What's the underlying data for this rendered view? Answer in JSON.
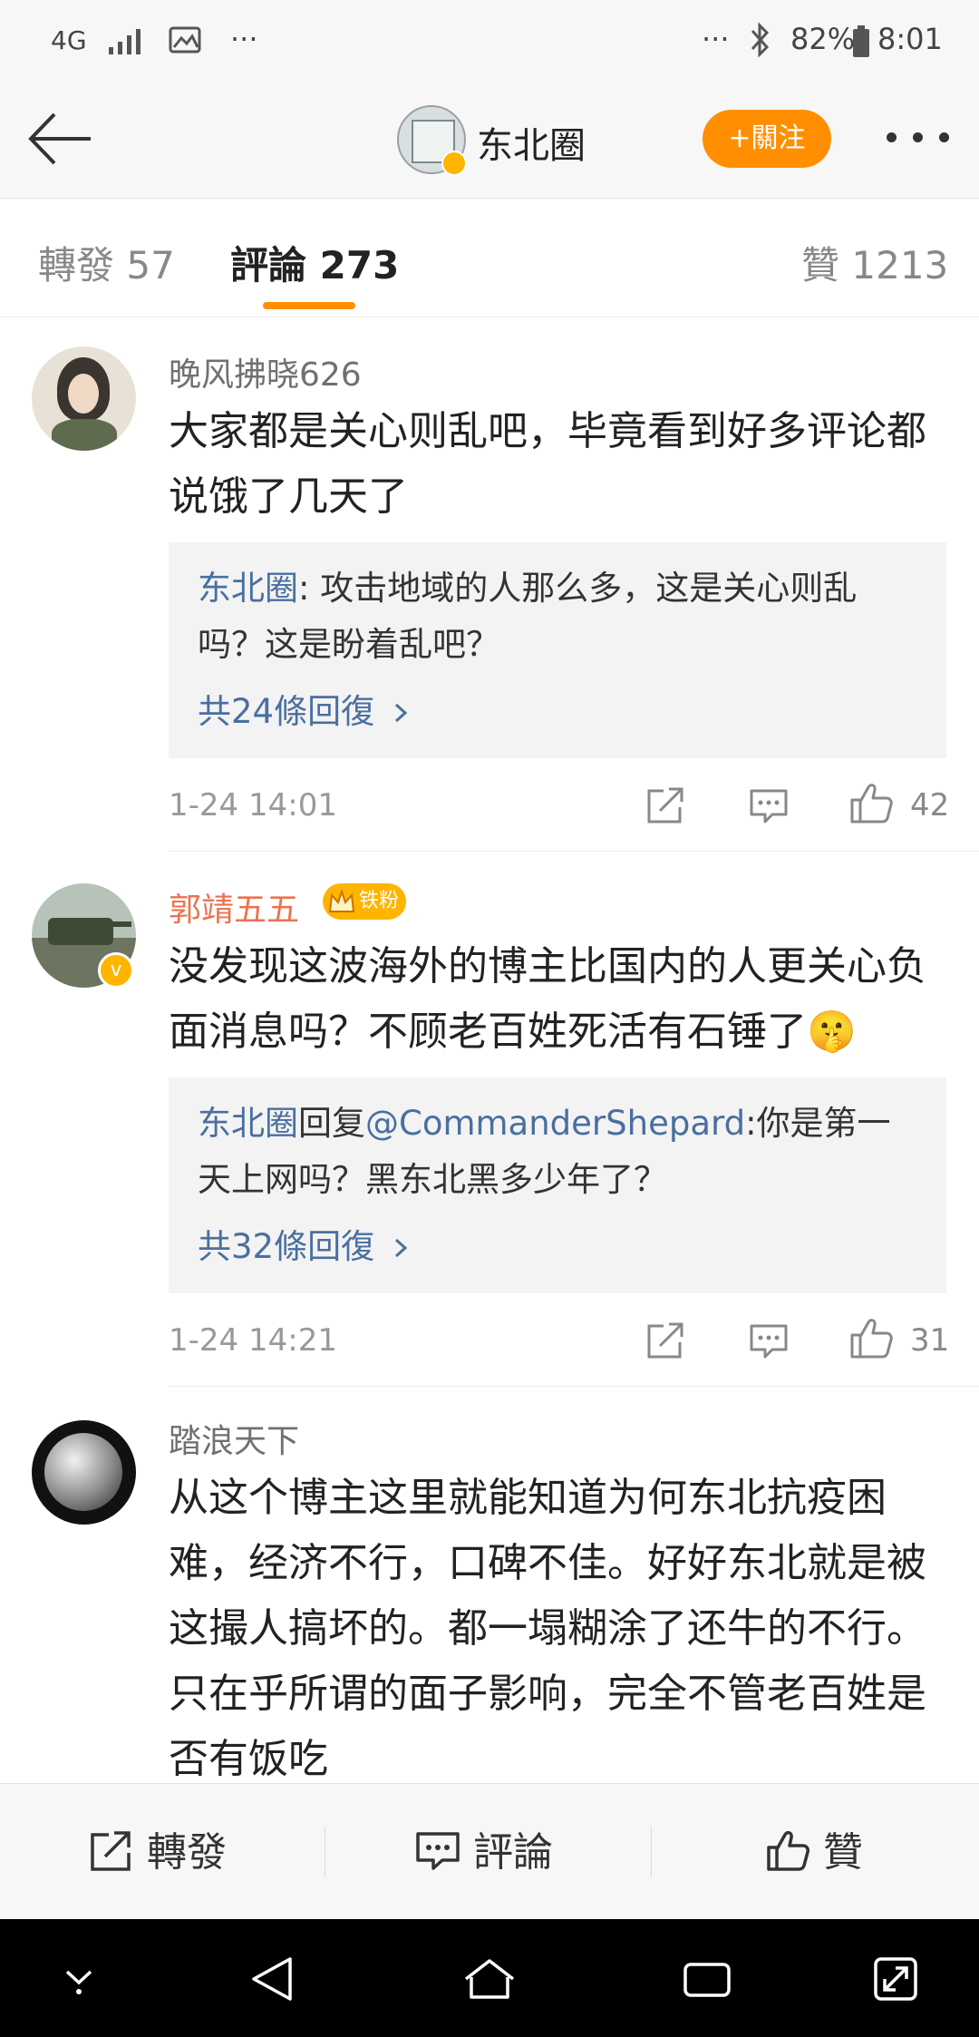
{
  "status": {
    "network": "4G",
    "battery": "82%",
    "time": "8:01",
    "more": "···",
    "right_more": "···"
  },
  "header": {
    "account_name": "东北圈",
    "follow_label": "+關注"
  },
  "tabs": [
    {
      "label": "轉發",
      "count": "57"
    },
    {
      "label": "評論",
      "count": "273"
    },
    {
      "label": "贊",
      "count": "1213"
    }
  ],
  "comments": [
    {
      "user": "晚风拂晓626",
      "text": "大家都是关心则乱吧，毕竟看到好多评论都说饿了几天了",
      "reply": {
        "author": "东北圈",
        "connector": "",
        "mention": "",
        "text": ": 攻击地域的人那么多，这是关心则乱吗？这是盼着乱吧？"
      },
      "reply_count": "共24條回復",
      "time": "1-24 14:01",
      "likes": "42"
    },
    {
      "user": "郭靖五五",
      "badge": "铁粉",
      "text": "没发现这波海外的博主比国内的人更关心负面消息吗？不顾老百姓死活有石锤了🤫",
      "reply": {
        "author": "东北圈",
        "connector": "回复",
        "mention": "@CommanderShepard",
        "text": ":你是第一天上网吗？黑东北黑多少年了？"
      },
      "reply_count": "共32條回復",
      "time": "1-24 14:21",
      "likes": "31"
    },
    {
      "user": "踏浪天下",
      "text": "从这个博主这里就能知道为何东北抗疫困难，经济不行，口碑不佳。好好东北就是被这撮人搞坏的。都一塌糊涂了还牛的不行。只在乎所谓的面子影响，完全不管老百姓是否有饭吃"
    }
  ],
  "bottom_bar": {
    "repost": "轉發",
    "comment": "評論",
    "like": "贊"
  },
  "colors": {
    "accent": "#ff8f00",
    "link": "#4a6f9f",
    "fan_name": "#eb7350"
  }
}
